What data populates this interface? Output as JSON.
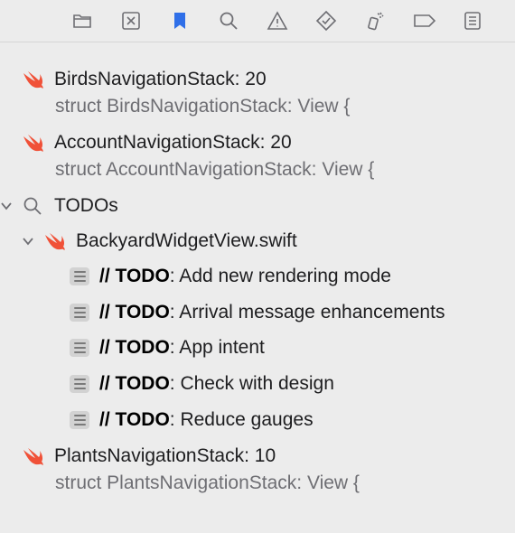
{
  "toolbar": {
    "icons": [
      "folder-icon",
      "source-control-icon",
      "bookmark-icon",
      "search-icon",
      "warning-icon",
      "test-icon",
      "debug-icon",
      "breakpoint-icon",
      "report-icon"
    ],
    "active_color": "#2f6fe8"
  },
  "results": [
    {
      "title": "BirdsNavigationStack: 20",
      "subtitle": "struct BirdsNavigationStack: View {"
    },
    {
      "title": "AccountNavigationStack: 20",
      "subtitle": "struct AccountNavigationStack: View {"
    }
  ],
  "todos_group": {
    "label": "TODOs",
    "file": "BackyardWidgetView.swift",
    "items": [
      {
        "prefix": "// TODO",
        "text": ": Add new rendering mode"
      },
      {
        "prefix": "// TODO",
        "text": ": Arrival message enhancements"
      },
      {
        "prefix": "// TODO",
        "text": ": App intent"
      },
      {
        "prefix": "// TODO",
        "text": ": Check with design"
      },
      {
        "prefix": "// TODO",
        "text": ": Reduce gauges"
      }
    ]
  },
  "plants": {
    "title": "PlantsNavigationStack: 10",
    "subtitle": "struct PlantsNavigationStack: View {"
  },
  "colors": {
    "swift": "#f05138",
    "background": "#ececec"
  }
}
